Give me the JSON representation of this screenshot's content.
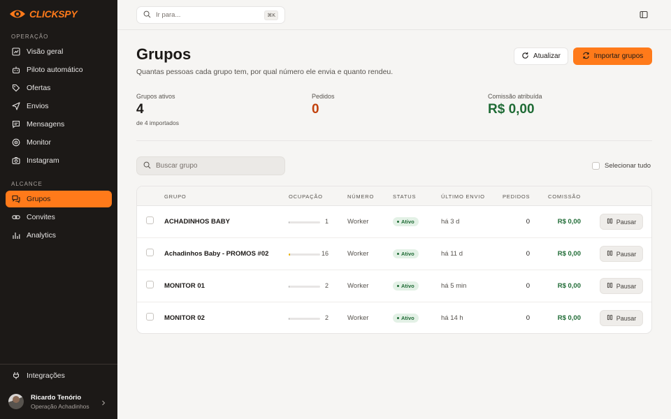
{
  "brand": {
    "name": "CLICKSPY",
    "accent": "#ff7a1a"
  },
  "sidebar": {
    "section_operacao": "OPERAÇÃO",
    "section_alcance": "ALCANCE",
    "items_operacao": [
      {
        "label": "Visão geral",
        "icon": "chart-square-icon"
      },
      {
        "label": "Piloto automático",
        "icon": "robot-icon"
      },
      {
        "label": "Ofertas",
        "icon": "tag-icon"
      },
      {
        "label": "Envios",
        "icon": "send-icon"
      },
      {
        "label": "Mensagens",
        "icon": "message-icon"
      },
      {
        "label": "Monitor",
        "icon": "radar-icon"
      },
      {
        "label": "Instagram",
        "icon": "camera-icon"
      }
    ],
    "items_alcance": [
      {
        "label": "Grupos",
        "icon": "groups-icon",
        "active": true
      },
      {
        "label": "Convites",
        "icon": "link-icon"
      },
      {
        "label": "Analytics",
        "icon": "bar-chart-icon"
      }
    ],
    "integrations": {
      "label": "Integrações",
      "icon": "plug-icon"
    },
    "user": {
      "name": "Ricardo Tenório",
      "role": "Operação Achadinhos"
    }
  },
  "topbar": {
    "search_placeholder": "Ir para...",
    "shortcut": "⌘K"
  },
  "header": {
    "title": "Grupos",
    "subtitle": "Quantas pessoas cada grupo tem, por qual número ele envia e quanto rendeu.",
    "refresh_label": "Atualizar",
    "import_label": "Importar grupos"
  },
  "stats": [
    {
      "label": "Grupos ativos",
      "value": "4",
      "note": "de 4 importados",
      "color": "#1c1917"
    },
    {
      "label": "Pedidos",
      "value": "0",
      "note": "",
      "color": "#c2410c"
    },
    {
      "label": "Comissão atribuída",
      "value": "R$ 0,00",
      "note": "",
      "color": "#1f6b35"
    }
  ],
  "filters": {
    "search_placeholder": "Buscar grupo",
    "select_all_label": "Selecionar tudo"
  },
  "table": {
    "columns": [
      "GRUPO",
      "OCUPAÇÃO",
      "NÚMERO",
      "STATUS",
      "ÚLTIMO ENVIO",
      "PEDIDOS",
      "COMISSÃO"
    ],
    "rows": [
      {
        "name": "ACHADINHOS BABY",
        "occupancy": "1",
        "occupancy_fraction": 0.01,
        "number": "Worker",
        "status": "Ativo",
        "last_send": "há 3 d",
        "orders": "0",
        "commission": "R$ 0,00",
        "action": "Pausar"
      },
      {
        "name": "Achadinhos Baby - PROMOS #02",
        "occupancy": "16",
        "occupancy_fraction": 0.04,
        "number": "Worker",
        "status": "Ativo",
        "last_send": "há 11 d",
        "orders": "0",
        "commission": "R$ 0,00",
        "action": "Pausar"
      },
      {
        "name": "MONITOR 01",
        "occupancy": "2",
        "occupancy_fraction": 0.01,
        "number": "Worker",
        "status": "Ativo",
        "last_send": "há 5 min",
        "orders": "0",
        "commission": "R$ 0,00",
        "action": "Pausar"
      },
      {
        "name": "MONITOR 02",
        "occupancy": "2",
        "occupancy_fraction": 0.01,
        "number": "Worker",
        "status": "Ativo",
        "last_send": "há 14 h",
        "orders": "0",
        "commission": "R$ 0,00",
        "action": "Pausar"
      }
    ]
  }
}
